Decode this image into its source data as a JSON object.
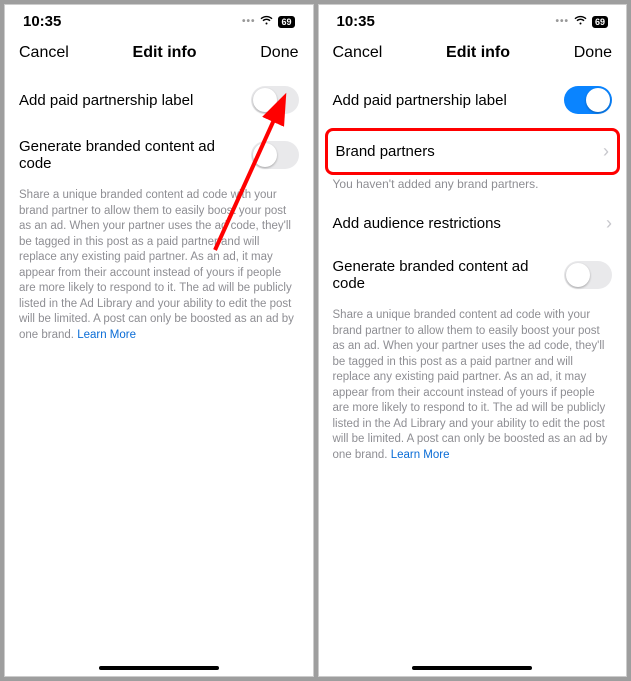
{
  "status": {
    "time": "10:35",
    "battery": "69"
  },
  "nav": {
    "cancel": "Cancel",
    "title": "Edit info",
    "done": "Done"
  },
  "left": {
    "paid_label": "Add paid partnership label",
    "gen_code": "Generate branded content ad code",
    "helper": "Share a unique branded content ad code with your brand partner to allow them to easily boost your post as an ad. When your partner uses the ad code, they'll be tagged in this post as a paid partner and will replace any existing paid partner. As an ad, it may appear from their account instead of yours if people are more likely to respond to it. The ad will be publicly listed in the Ad Library and your ability to edit the post will be limited. A post can only be boosted as an ad by one brand.",
    "learn_more": "Learn More"
  },
  "right": {
    "paid_label": "Add paid partnership label",
    "brand_partners": "Brand partners",
    "brand_hint": "You haven't added any brand partners.",
    "audience": "Add audience restrictions",
    "gen_code": "Generate branded content ad code",
    "helper": "Share a unique branded content ad code with your brand partner to allow them to easily boost your post as an ad. When your partner uses the ad code, they'll be tagged in this post as a paid partner and will replace any existing paid partner. As an ad, it may appear from their account instead of yours if people are more likely to respond to it. The ad will be publicly listed in the Ad Library and your ability to edit the post will be limited. A post can only be boosted as an ad by one brand.",
    "learn_more": "Learn More"
  }
}
